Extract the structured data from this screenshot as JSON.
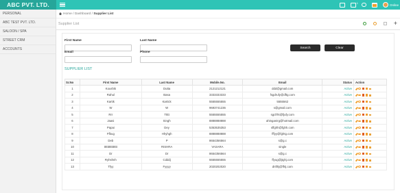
{
  "header": {
    "brand": "ABC PVT. LTD.",
    "user": "Online"
  },
  "sidebar": {
    "items": [
      {
        "label": "PERSONAL"
      },
      {
        "label": "ABC TEST PVT. LTD."
      },
      {
        "label": "SALOON / SPA"
      },
      {
        "label": "STREET CRM"
      },
      {
        "label": "ACCOUNTS"
      }
    ]
  },
  "breadcrumb": {
    "home": "Home",
    "sep1": "/",
    "dashboard": "Dashboard",
    "sep2": "/",
    "current": "Supplier List"
  },
  "page": {
    "title": "Supplier List"
  },
  "form": {
    "first_name_label": "First Name",
    "first_name_value": "",
    "last_name_label": "Last Name",
    "last_name_value": "",
    "email_label": "Email",
    "email_value": "",
    "phone_label": "Phone",
    "phone_value": "",
    "search_label": "Search",
    "clear_label": "Clear"
  },
  "list_title": "SUPPLIER LIST",
  "table": {
    "headers": [
      "Sr.No",
      "First Name",
      "Last Name",
      "Mobile.No.",
      "Email",
      "Status",
      "Action"
    ],
    "rows": [
      [
        "1",
        "Koushik",
        "Dutta",
        "2121212121",
        "ddd@gmail.com",
        "Active"
      ],
      [
        "2",
        "Rahul",
        "Basa",
        "3333333333",
        "fsgdrufy@dftg.com",
        "Active"
      ],
      [
        "3",
        "Kartik",
        "Kartick",
        "5555555555",
        "5555562",
        "Active"
      ],
      [
        "4",
        "W",
        "W",
        "9693741236",
        "s@gmail.com",
        "Active"
      ],
      [
        "5",
        "Rrr",
        "Ttttt",
        "5555555555",
        "sgcfrht@fjufy.com",
        "Active"
      ],
      [
        "6",
        "Jaasi",
        "Singh",
        "8888888888",
        "ahinganirg@hotmail.com",
        "Active"
      ],
      [
        "7",
        "Papai",
        "Dey",
        "5353535353",
        "sffghh@fghh.com",
        "Active"
      ],
      [
        "8",
        "Ffbug",
        "Hhyhgh",
        "8888888888",
        "fffyy@fghtg.com",
        "Active"
      ],
      [
        "9",
        "Deb",
        "P",
        "8654356564",
        "s@g.c",
        "Active"
      ],
      [
        "10",
        "tttttttttttttttt",
        "RISHRA",
        "VASARA",
        "single",
        "Active"
      ],
      [
        "11",
        "Dr",
        "Dr",
        "8654356564",
        "s@g.c",
        "Active"
      ],
      [
        "12",
        "Ryhshnh",
        "Cdddj",
        "5555555555",
        "ffyug@jtghj.com",
        "Active"
      ],
      [
        "13",
        "Tfyy",
        "Fyyyy",
        "2020202020",
        "dnfthj@fhtj.com",
        "Active"
      ]
    ]
  },
  "colors": {
    "topbar": "#2ec4b6",
    "brand_bg": "#26a69a",
    "status_active": "#26a69a",
    "action_icon": "#f0a030",
    "action_delete": "#e05d1f"
  },
  "icons": [
    "menu-icon",
    "contact-card-icon",
    "flag-icon",
    "chat-icon",
    "calendar-icon",
    "home-icon",
    "refresh-icon",
    "collapse-icon",
    "close-icon",
    "add-icon",
    "edit-icon",
    "link-icon",
    "delete-icon",
    "calendar-icon",
    "list-icon"
  ]
}
